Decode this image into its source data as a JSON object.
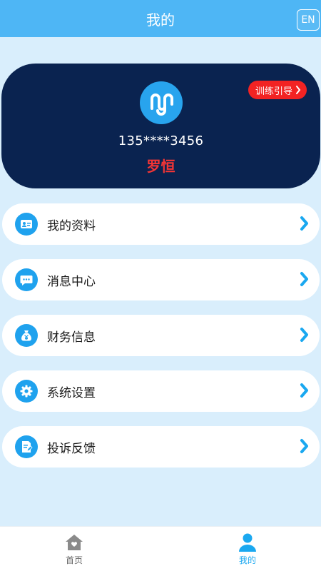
{
  "header": {
    "title": "我的",
    "lang_button": "EN"
  },
  "profile": {
    "phone": "135****3456",
    "name": "罗恒",
    "guide_button": "训练引导"
  },
  "menu": [
    {
      "label": "我的资料",
      "icon": "id-card-icon"
    },
    {
      "label": "消息中心",
      "icon": "chat-bubble-icon"
    },
    {
      "label": "财务信息",
      "icon": "money-bag-icon"
    },
    {
      "label": "系统设置",
      "icon": "gear-icon"
    },
    {
      "label": "投诉反馈",
      "icon": "feedback-doc-icon"
    }
  ],
  "tabbar": {
    "tabs": [
      {
        "label": "首页",
        "icon": "home-icon",
        "active": false
      },
      {
        "label": "我的",
        "icon": "person-icon",
        "active": true
      }
    ]
  },
  "colors": {
    "header": "#4eb6f5",
    "card": "#0a2350",
    "accent": "#1fa2ee",
    "name_red": "#f53535",
    "guide_red": "#f22323",
    "arrow": "#1aa8f0",
    "tab_active": "#1aa8f0",
    "tab_inactive": "#666666"
  }
}
